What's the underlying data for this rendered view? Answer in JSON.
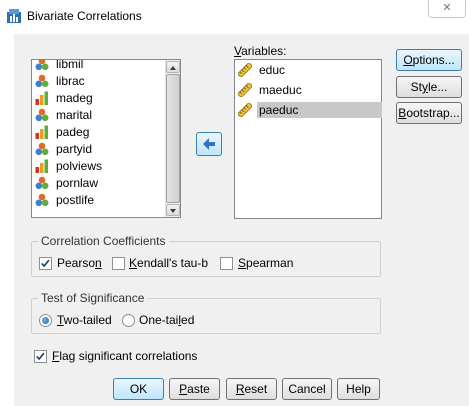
{
  "window": {
    "title": "Bivariate Correlations",
    "close_glyph": "✕"
  },
  "source_list": {
    "items": [
      {
        "label": "libmil",
        "type": "nominal"
      },
      {
        "label": "librac",
        "type": "nominal"
      },
      {
        "label": "madeg",
        "type": "ordinal"
      },
      {
        "label": "marital",
        "type": "nominal"
      },
      {
        "label": "padeg",
        "type": "ordinal"
      },
      {
        "label": "partyid",
        "type": "nominal"
      },
      {
        "label": "polviews",
        "type": "ordinal"
      },
      {
        "label": "pornlaw",
        "type": "nominal"
      },
      {
        "label": "postlife",
        "type": "nominal"
      }
    ]
  },
  "move_button": {
    "icon": "arrow-left-icon"
  },
  "variables": {
    "label_prefix": "",
    "label_mnemonic": "V",
    "label_rest": "ariables:",
    "items": [
      {
        "label": "educ",
        "type": "scale",
        "selected": false
      },
      {
        "label": "maeduc",
        "type": "scale",
        "selected": false
      },
      {
        "label": "paeduc",
        "type": "scale",
        "selected": true
      }
    ]
  },
  "side_buttons": {
    "options": {
      "pre": "",
      "mn": "O",
      "post": "ptions..."
    },
    "style": {
      "pre": "St",
      "mn": "y",
      "post": "le..."
    },
    "bootstrap": {
      "pre": "",
      "mn": "B",
      "post": "ootstrap..."
    }
  },
  "correlation_coefficients": {
    "title": "Correlation Coefficients",
    "pearson": {
      "pre": "Pearso",
      "mn": "n",
      "post": "",
      "checked": true
    },
    "kendall": {
      "pre": "",
      "mn": "K",
      "post": "endall's tau-b",
      "checked": false
    },
    "spearman": {
      "pre": "",
      "mn": "S",
      "post": "pearman",
      "checked": false
    }
  },
  "test_of_significance": {
    "title": "Test of Significance",
    "two_tailed": {
      "pre": "",
      "mn": "T",
      "post": "wo-tailed",
      "selected": true
    },
    "one_tailed": {
      "pre": "One-tai",
      "mn": "l",
      "post": "ed",
      "selected": false
    }
  },
  "flag": {
    "pre": "",
    "mn": "F",
    "post": "lag significant correlations",
    "checked": true
  },
  "bottom_buttons": {
    "ok": "OK",
    "paste": {
      "pre": "",
      "mn": "P",
      "post": "aste"
    },
    "reset": {
      "pre": "",
      "mn": "R",
      "post": "eset"
    },
    "cancel": "Cancel",
    "help": "Help"
  },
  "colors": {
    "accent": "#3c7fb1",
    "selection": "#c8c8c8",
    "dialog_bg": "#f0f0f0"
  }
}
